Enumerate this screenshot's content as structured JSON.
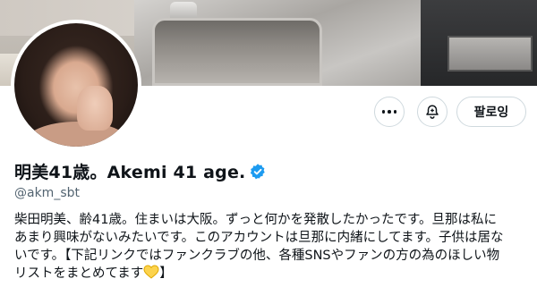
{
  "profile": {
    "display_name": "明美41歳。Akemi 41 age.",
    "handle": "@akm_sbt",
    "verified": true,
    "bio_lines": [
      "柴田明美、齢41歳。住まいは大阪。ずっと何かを発散したかったです。旦那は私に",
      "あまり興味がないみたいです。このアカウントは旦那に内緒にしてます。子供は居な",
      "いです。【下記リンクではファンクラブの他、各種SNSやファンの方の為のほしい物",
      "リストをまとめてます",
      "】"
    ]
  },
  "actions": {
    "more_label": "",
    "notify_label": "",
    "follow_label": "팔로잉"
  },
  "icons": {
    "more": "more-horizontal-icon",
    "notify": "bell-plus-icon",
    "verified": "verified-badge-icon",
    "bio_emoji": "yellow-heart-hands-icon"
  },
  "colors": {
    "verified_blue": "#1d9bf0",
    "text_primary": "#0f1419",
    "text_secondary": "#536471",
    "border": "#cfd9de"
  }
}
